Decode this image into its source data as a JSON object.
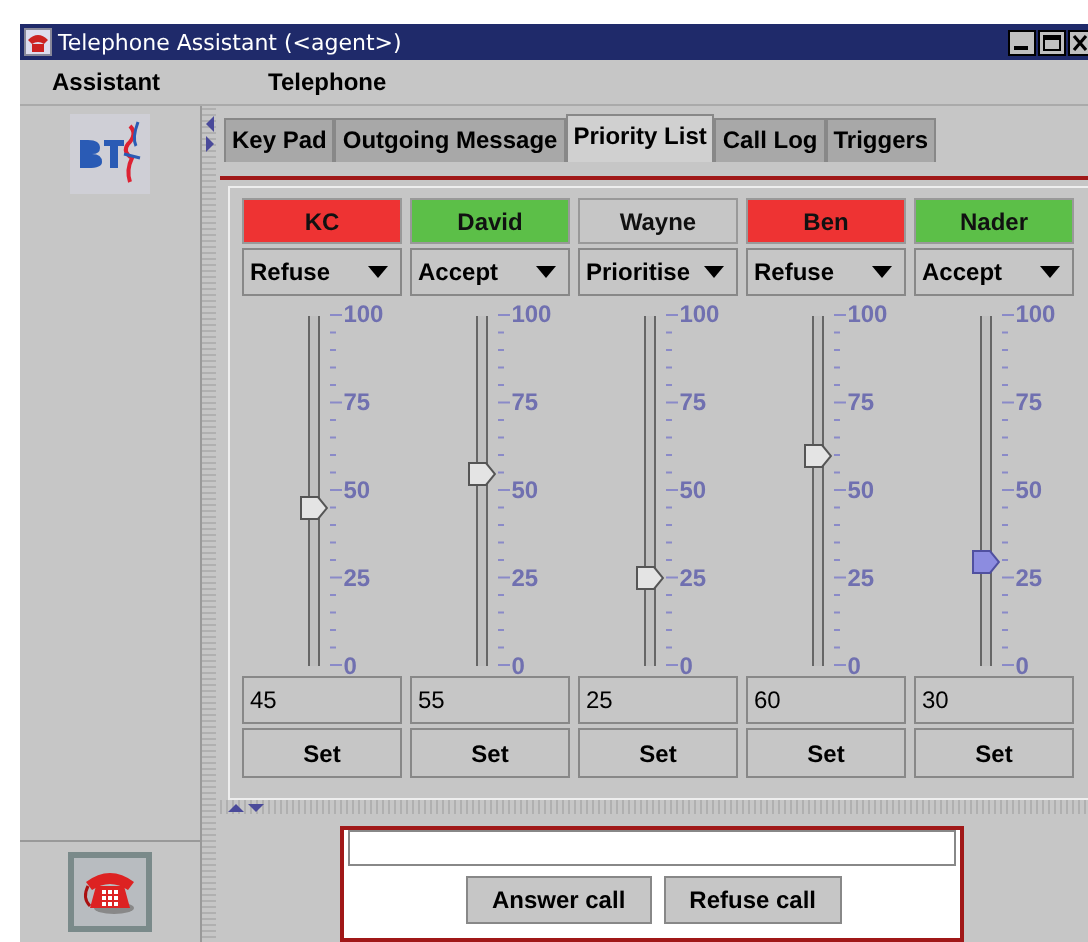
{
  "window": {
    "title": "Telephone Assistant (<agent>)"
  },
  "menu": [
    "Assistant",
    "Telephone"
  ],
  "tabs": [
    {
      "label": "Key Pad",
      "selected": false
    },
    {
      "label": "Outgoing Message",
      "selected": false
    },
    {
      "label": "Priority List",
      "selected": true
    },
    {
      "label": "Call Log",
      "selected": false
    },
    {
      "label": "Triggers",
      "selected": false
    }
  ],
  "contacts": [
    {
      "name": "KC",
      "color": "#ee3333",
      "action": "Refuse",
      "level": 0.45,
      "focused": false,
      "scale": [
        "100",
        "75",
        "50",
        "25",
        "0"
      ],
      "value": "45",
      "button": "Set"
    },
    {
      "name": "David",
      "color": "#5cbf48",
      "action": "Accept",
      "level": 0.55,
      "focused": false,
      "scale": [
        "100",
        "75",
        "50",
        "25",
        "0"
      ],
      "value": "55",
      "button": "Set"
    },
    {
      "name": "Wayne",
      "color": "#c6c6c6",
      "action": "Prioritise",
      "level": 0.25,
      "focused": false,
      "scale": [
        "100",
        "75",
        "50",
        "25",
        "0"
      ],
      "value": "25",
      "button": "Set"
    },
    {
      "name": "Ben",
      "color": "#ee3333",
      "action": "Refuse",
      "level": 0.6,
      "focused": false,
      "scale": [
        "100",
        "75",
        "50",
        "25",
        "0"
      ],
      "value": "60",
      "button": "Set"
    },
    {
      "name": "Nader",
      "color": "#5cbf48",
      "action": "Accept",
      "level": 0.3,
      "focused": true,
      "scale": [
        "100",
        "75",
        "50",
        "25",
        "0"
      ],
      "value": "30",
      "button": "Set"
    }
  ],
  "call_panel": {
    "buttons": [
      "Answer call",
      "Refuse call"
    ]
  }
}
